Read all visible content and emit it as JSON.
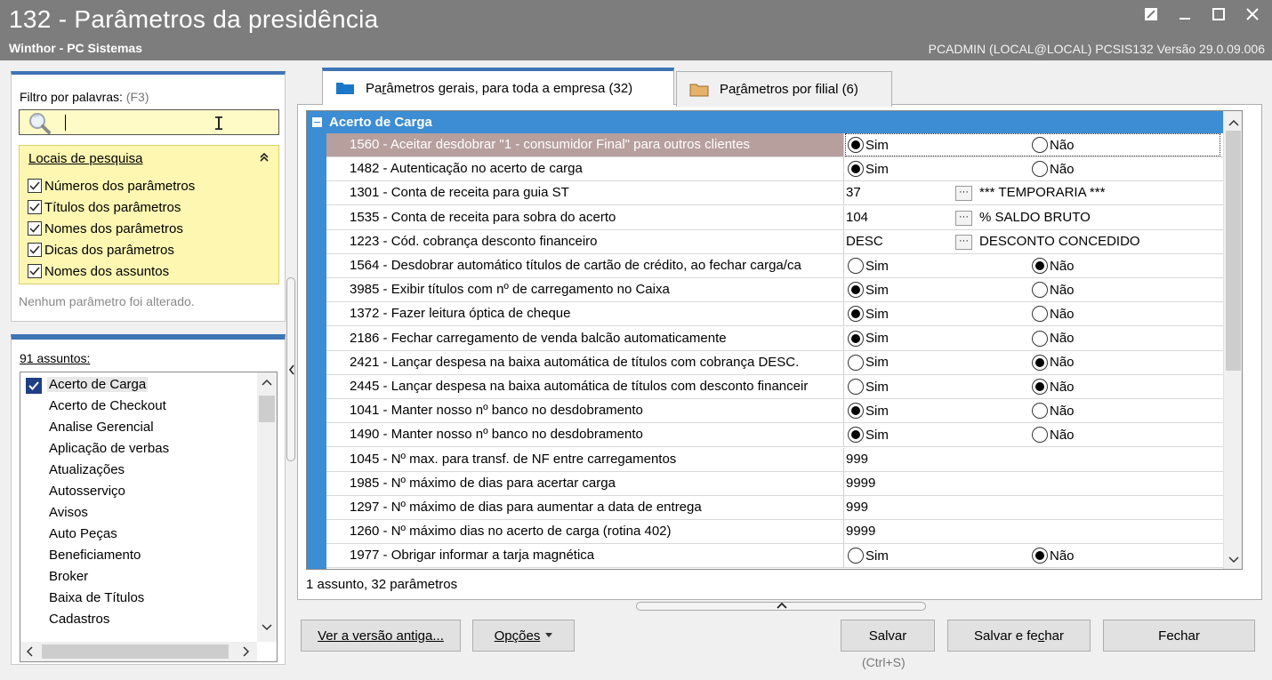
{
  "window": {
    "title": "132 - Parâmetros da presidência",
    "subtitle": "Winthor - PC Sistemas",
    "user_info": "PCADMIN (LOCAL@LOCAL)  PCSIS132  Versão  29.0.09.006"
  },
  "filter": {
    "label": "Filtro por palavras:",
    "shortcut_hint": "(F3)",
    "search_value": ""
  },
  "search_locations": {
    "heading": "Locais de pesquisa",
    "options": [
      {
        "label": "Números dos parâmetros",
        "checked": true
      },
      {
        "label": "Títulos dos parâmetros",
        "checked": true
      },
      {
        "label": "Nomes dos parâmetros",
        "checked": true
      },
      {
        "label": "Dicas dos parâmetros",
        "checked": true
      },
      {
        "label": "Nomes dos assuntos",
        "checked": true
      }
    ]
  },
  "change_status": "Nenhum parâmetro foi alterado.",
  "subjects": {
    "count_label": "91 assuntos:",
    "items": [
      "Acerto de Carga",
      "Acerto de Checkout",
      "Analise Gerencial",
      "Aplicação de verbas",
      "Atualizações",
      "Autosserviço",
      "Avisos",
      "Auto Peças",
      "Beneficiamento",
      "Broker",
      "Baixa de Títulos",
      "Cadastros"
    ],
    "selected": "Acerto de Carga"
  },
  "tabs": [
    {
      "label_pre": "Pa",
      "label_u": "r",
      "label_post": "âmetros gerais, para toda a empresa  (32)",
      "active": true
    },
    {
      "label_pre": "Pa",
      "label_u": "r",
      "label_post": "âmetros por filial  (6)",
      "active": false
    }
  ],
  "grid": {
    "group": "Acerto de Carga",
    "radio_yes": "Sim",
    "radio_no": "Não",
    "rows": [
      {
        "name": "1560 - Aceitar desdobrar \"1 - consumidor Final\" para outros clientes",
        "type": "radio",
        "value": "Sim"
      },
      {
        "name": "1482 - Autenticação no acerto de carga",
        "type": "radio",
        "value": "Sim"
      },
      {
        "name": "1301 - Conta de receita para guia ST",
        "type": "lookup",
        "value": "37",
        "description": "*** TEMPORARIA ***"
      },
      {
        "name": "1535 - Conta de receita para sobra do acerto",
        "type": "lookup",
        "value": "104",
        "description": "% SALDO BRUTO"
      },
      {
        "name": "1223 - Cód. cobrança desconto financeiro",
        "type": "lookup",
        "value": "DESC",
        "description": "DESCONTO CONCEDIDO"
      },
      {
        "name": "1564 - Desdobrar automático títulos de cartão de crédito, ao fechar carga/ca",
        "type": "radio",
        "value": "Não"
      },
      {
        "name": "3985 - Exibir títulos com nº de carregamento no Caixa",
        "type": "radio",
        "value": "Sim"
      },
      {
        "name": "1372 - Fazer leitura óptica de cheque",
        "type": "radio",
        "value": "Sim"
      },
      {
        "name": "2186 - Fechar carregamento de venda balcão automaticamente",
        "type": "radio",
        "value": "Sim"
      },
      {
        "name": "2421 - Lançar despesa na baixa automática de títulos com cobrança DESC.",
        "type": "radio",
        "value": "Não"
      },
      {
        "name": "2445 - Lançar despesa na baixa automática de títulos com desconto financeir",
        "type": "radio",
        "value": "Não"
      },
      {
        "name": "1041 - Manter nosso nº banco no desdobramento",
        "type": "radio",
        "value": "Sim"
      },
      {
        "name": "1490 - Manter nosso nº banco no desdobramento",
        "type": "radio",
        "value": "Sim"
      },
      {
        "name": "1045 - Nº max. para transf. de NF entre carregamentos",
        "type": "text",
        "value": "999"
      },
      {
        "name": "1985 - Nº máximo de dias para acertar carga",
        "type": "text",
        "value": "9999"
      },
      {
        "name": "1297 - Nº máximo de dias para aumentar a data de entrega",
        "type": "text",
        "value": "999"
      },
      {
        "name": "1260 - Nº máximo dias no acerto de carga (rotina 402)",
        "type": "text",
        "value": "9999"
      },
      {
        "name": "1977 - Obrigar informar a tarja magnética",
        "type": "radio",
        "value": "Não"
      }
    ],
    "selected_row": 0
  },
  "status_bar": "1 assunto, 32 parâmetros",
  "buttons": {
    "old_version": "Ver a versão antiga...",
    "options": "Opções",
    "save": "Salvar",
    "save_shortcut": "(Ctrl+S)",
    "save_close_pre": "Salvar e fe",
    "save_close_u": "c",
    "save_close_post": "har",
    "close": "Fechar"
  },
  "colors": {
    "titlebar": "#7d7d7d",
    "accent": "#3c8dd3",
    "search_bg": "#fffbc6",
    "selected_row": "#b79f9e"
  }
}
